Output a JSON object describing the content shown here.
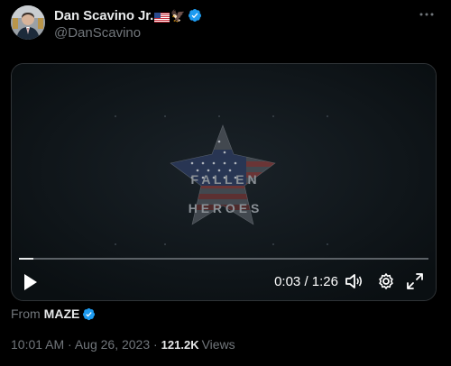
{
  "author": {
    "display_name": "Dan Scavino Jr.",
    "handle": "@DanScavino",
    "emoji_eagle": "🦅",
    "avatar_icon": "avatar-photo",
    "verified_icon": "verified-badge-icon"
  },
  "video": {
    "title_line1": "F A L L E N",
    "title_line2": "H E R O E S",
    "current_time": "0:03",
    "separator": " / ",
    "duration": "1:26",
    "progress": 0.035
  },
  "source": {
    "from_label": "From",
    "brand": "MAZE"
  },
  "meta": {
    "timestamp": "10:01 AM · Aug 26, 2023 · ",
    "views_count": "121.2K",
    "views_label": "Views"
  },
  "colors": {
    "background": "#000000",
    "verified_blue": "#1d9bf0",
    "secondary_text": "#71767b",
    "primary_text": "#e7e9ea"
  }
}
